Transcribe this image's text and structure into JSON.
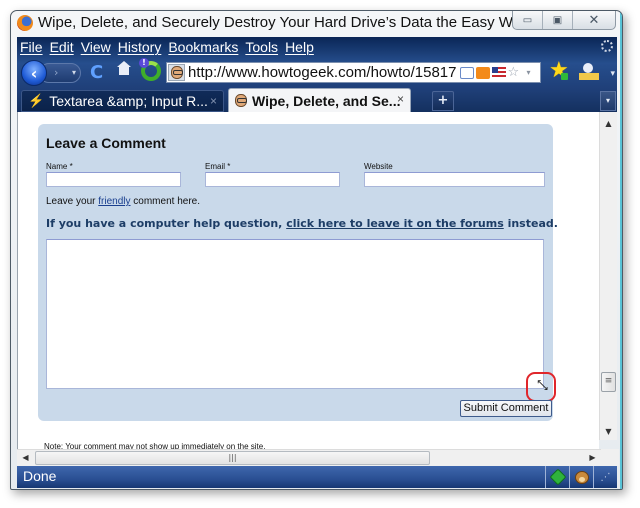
{
  "window": {
    "title": "Wipe, Delete, and Securely Destroy Your Hard Drive’s Data the Easy Way - H...",
    "controls": {
      "minimize": "▭",
      "maximize": "▣",
      "close": "✕"
    }
  },
  "menubar": {
    "items": [
      "File",
      "Edit",
      "View",
      "History",
      "Bookmarks",
      "Tools",
      "Help"
    ]
  },
  "navbar": {
    "back_icon": "‹",
    "forward_icon": "›",
    "dropdown_icon": "▾",
    "reload_icon": "C",
    "url": "http://www.howtogeek.com/howto/15817"
  },
  "tabs": [
    {
      "label": "Textarea &amp; Input R...",
      "active": false,
      "close": "×"
    },
    {
      "label": "Wipe, Delete, and Se...",
      "active": true,
      "close": "×"
    }
  ],
  "tabbar": {
    "new_tab": "+",
    "list_all": "▾"
  },
  "page": {
    "heading": "Leave a Comment",
    "fields": {
      "name_label": "Name *",
      "name_value": "",
      "email_label": "Email *",
      "email_value": "",
      "website_label": "Website",
      "website_value": ""
    },
    "intro_prefix": "Leave your ",
    "intro_link": "friendly",
    "intro_suffix": " comment here.",
    "help_prefix": "If you have a computer help question, ",
    "help_link": "click here to leave it on the forums",
    "help_suffix": " instead.",
    "comment_value": "",
    "submit_label": "Submit Comment",
    "note": "Note: Your comment may not show up immediately on the site."
  },
  "scrollbars": {
    "up": "▲",
    "down": "▼",
    "left": "◀",
    "right": "▶",
    "grip_v": "≡",
    "grip_h": "|||"
  },
  "statusbar": {
    "text": "Done",
    "grip": "⋰"
  },
  "colors": {
    "chrome_blue": "#264e8d",
    "comment_box": "#c9d9ea",
    "link": "#1a3f8f",
    "highlight": "#e0262b"
  }
}
